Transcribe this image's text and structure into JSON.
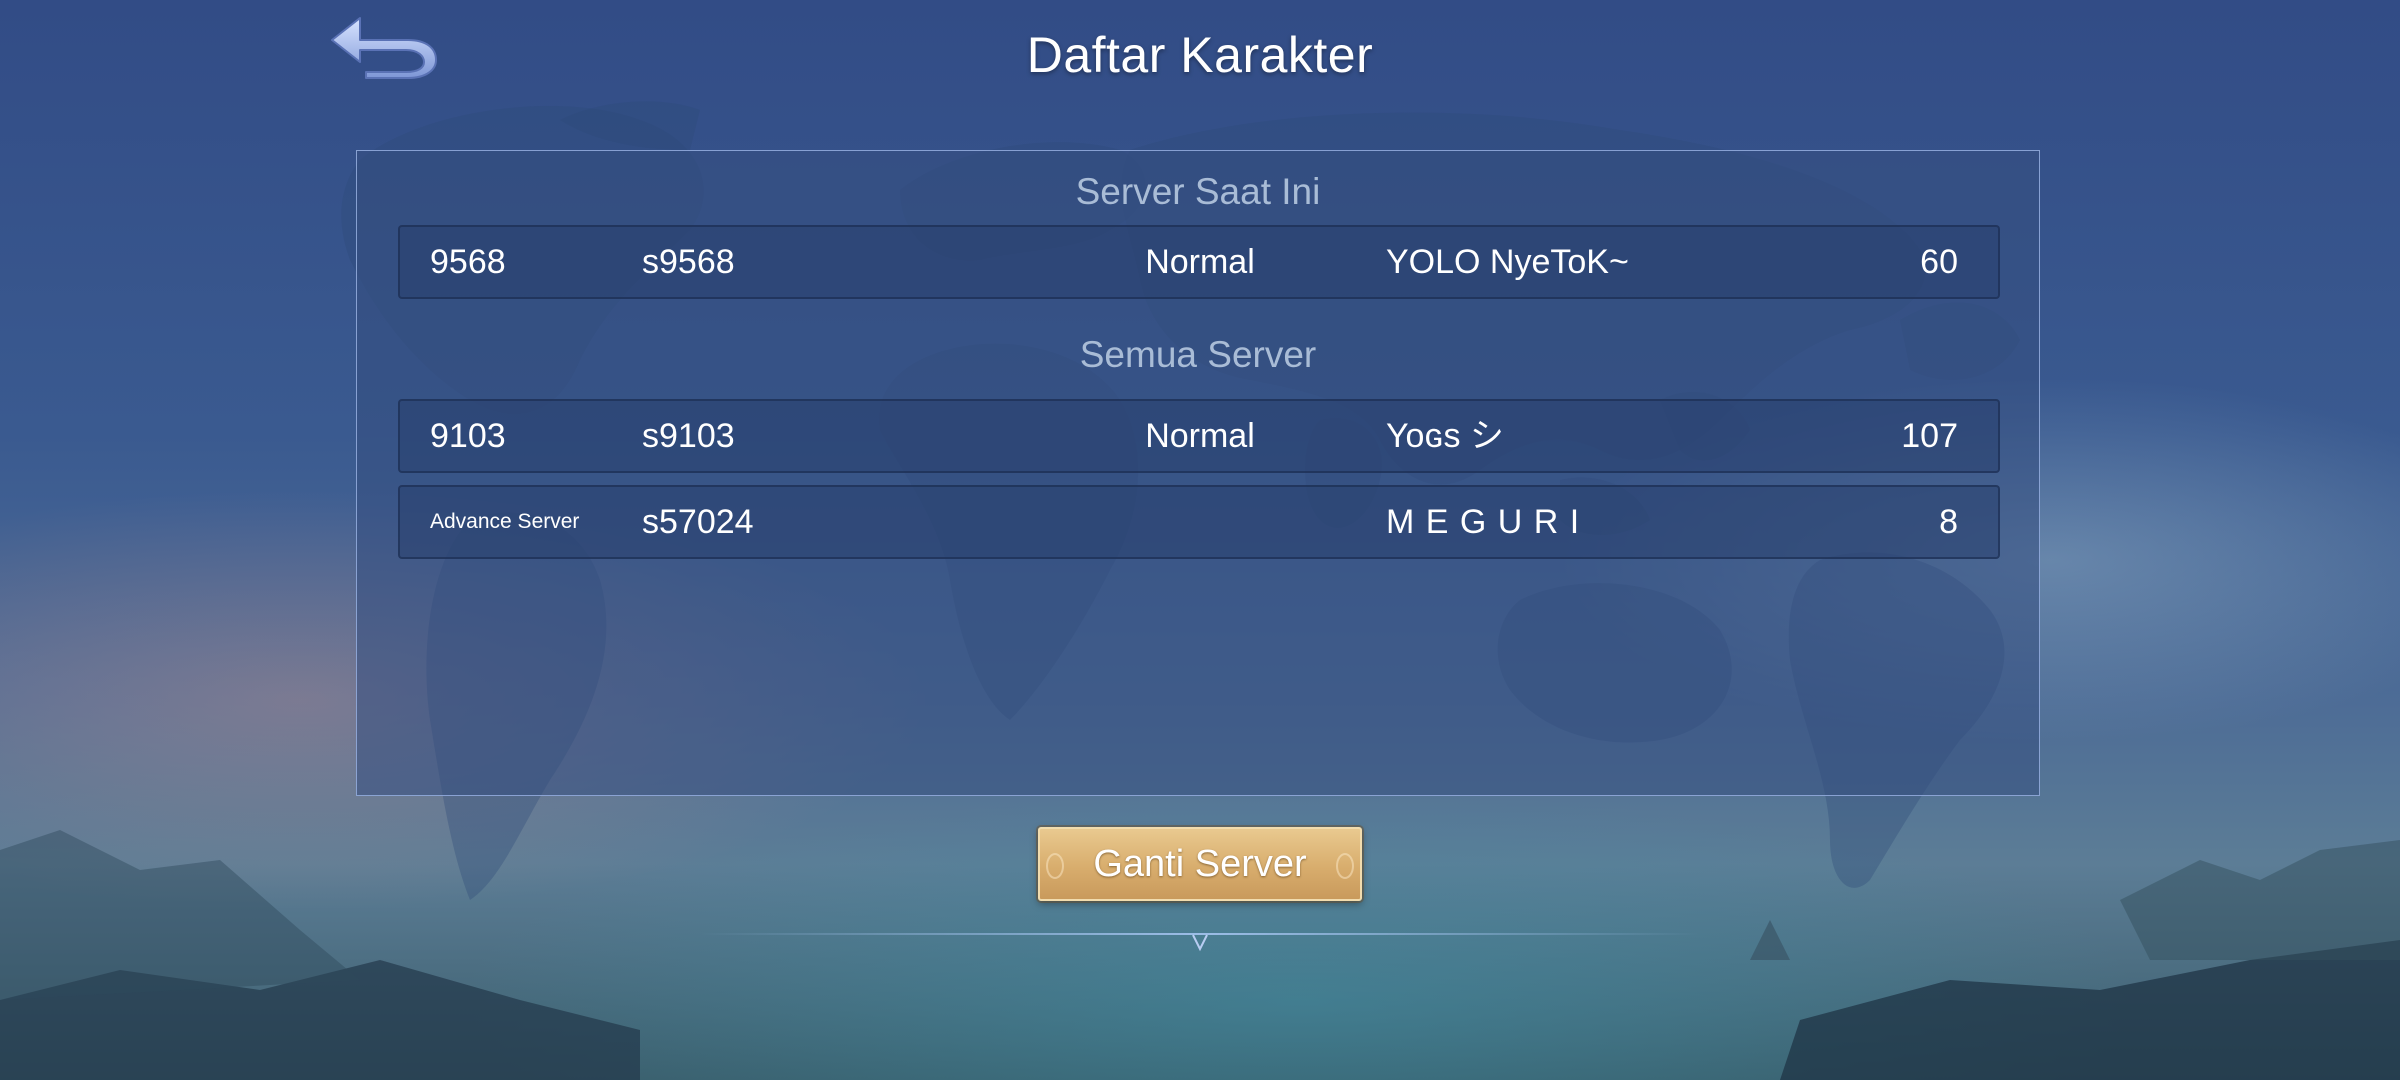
{
  "header": {
    "title": "Daftar Karakter",
    "back_icon": "back-arrow-icon"
  },
  "current_server": {
    "title": "Server Saat Ini",
    "rows": [
      {
        "id": "9568",
        "server": "s9568",
        "status": "Normal",
        "name": "YOLO NyeToK~",
        "level": "60"
      }
    ]
  },
  "all_servers": {
    "title": "Semua Server",
    "rows": [
      {
        "id": "9103",
        "server": "s9103",
        "status": "Normal",
        "name": "Yoɢs シ",
        "level": "107"
      },
      {
        "id": "Advance Server",
        "server": "s57024",
        "status": "",
        "name": "M E G U R I",
        "level": "8"
      }
    ]
  },
  "footer": {
    "switch_button": "Ganti Server"
  },
  "colors": {
    "background": "#3a5a90",
    "panel_border": "#96afe1",
    "section_title": "#a9bcd6",
    "button_gold": "#d8ad6d"
  }
}
